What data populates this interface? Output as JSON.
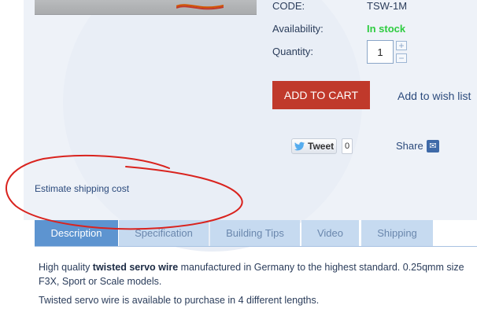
{
  "product": {
    "code_label": "CODE:",
    "code_value": "TSW-1M",
    "availability_label": "Availability:",
    "availability_value": "In stock",
    "quantity_label": "Quantity:",
    "quantity_value": "1",
    "stepper_plus": "+",
    "stepper_minus": "−"
  },
  "actions": {
    "add_to_cart": "ADD TO CART",
    "wishlist": "Add to wish list"
  },
  "social": {
    "tweet_label": "Tweet",
    "tweet_count": "0",
    "share_label": "Share"
  },
  "shipping": {
    "estimate_link": "Estimate shipping cost"
  },
  "tabs": [
    {
      "label": "Description",
      "active": true
    },
    {
      "label": "Specification",
      "active": false
    },
    {
      "label": "Building Tips",
      "active": false
    },
    {
      "label": "Video",
      "active": false
    },
    {
      "label": "Shipping",
      "active": false
    }
  ],
  "description": {
    "line1_prefix": "High quality ",
    "line1_bold": "twisted servo wire",
    "line1_suffix": " manufactured in Germany to the highest standard. 0.25qmm size",
    "line2": "F3X, Sport or Scale models.",
    "line3": "Twisted servo wire is available to purchase in 4 different lengths."
  },
  "colors": {
    "in_stock": "#2ecc40",
    "cart_button": "#c0392b",
    "tab_active": "#5d94d0",
    "tab_inactive": "#c6daf0",
    "annotation": "#d9231e"
  }
}
